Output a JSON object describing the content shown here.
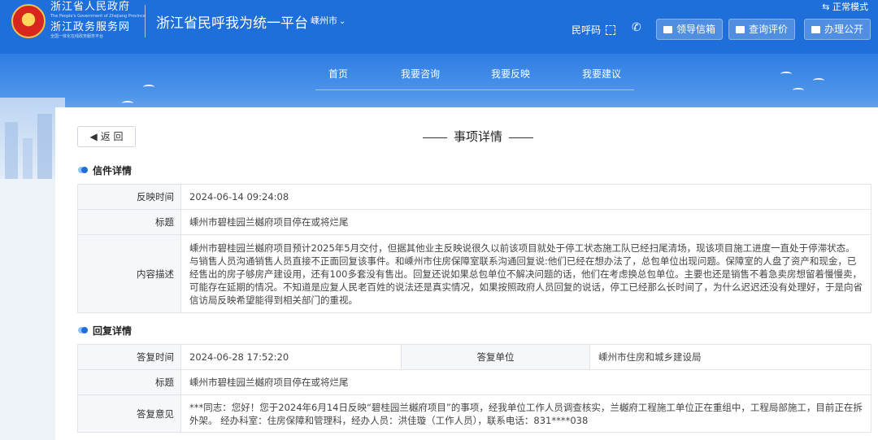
{
  "header": {
    "org_cn_1": "浙江省人民政府",
    "org_en_1": "The People's Government of Zhejiang Province",
    "org_cn_2": "浙江政务服务网",
    "org_en_2": "全国一体化在线政务服务平台",
    "platform_title": "浙江省民呼我为统一平台",
    "city": "嵊州市",
    "mode": "⇆ 正常模式",
    "hotline_label": "民呼码",
    "buttons": {
      "leader_mailbox": "领导信箱",
      "query_review": "查询评价",
      "public": "办理公开"
    }
  },
  "nav": {
    "home": "首页",
    "consult": "我要咨询",
    "feedback": "我要反映",
    "suggest": "我要建议"
  },
  "page": {
    "back_label": "返 回",
    "title": "事项详情"
  },
  "letter": {
    "section_title": "信件详情",
    "time_label": "反映时间",
    "time_value": "2024-06-14 09:24:08",
    "subject_label": "标题",
    "subject_value": "嵊州市碧桂园兰樾府项目停在或将烂尾",
    "content_label": "内容描述",
    "content_value": "嵊州市碧桂园兰樾府项目预计2025年5月交付，但据其他业主反映说很久以前该项目就处于停工状态施工队已经扫尾清场，现该项目施工进度一直处于停滞状态。与销售人员沟通销售人员直接不正面回复该事件。和嵊州市住房保障室联系沟通回复说:他们已经在想办法了，总包单位出现问题。保障室的人盘了资产和现金，已经售出的房子够房产建设用，还有100多套没有售出。回复还说如果总包单位不解决问题的话，他们在考虑换总包单位。主要也还是销售不着急卖房想留着慢慢卖，可能存在延期的情况。不知道是应复人民老百姓的说法还是真实情况，如果按照政府人员回复的说话，停工已经那么长时间了，为什么迟迟还没有处理好，于是向省信访局反映希望能得到相关部门的重视。"
  },
  "reply": {
    "section_title": "回复详情",
    "time_label": "答复时间",
    "time_value": "2024-06-28 17:52:20",
    "unit_label": "答复单位",
    "unit_value": "嵊州市住房和城乡建设局",
    "subject_label": "标题",
    "subject_value": "嵊州市碧桂园兰樾府项目停在或将烂尾",
    "opinion_label": "答复意见",
    "opinion_value": "***同志：您好！您于2024年6月14日反映“碧桂园兰樾府项目”的事项，经我单位工作人员调查核实，兰樾府工程施工单位正在重组中，工程局部施工，目前正在拆外架。 经办科室：住房保障和管理科，经办人员：洪佳璇（工作人员），联系电话：831****038"
  },
  "icons": [
    "national-emblem-icon",
    "chevron-down-icon",
    "switch-icon",
    "qr-code-icon",
    "phone-icon",
    "mail-icon",
    "comment-icon",
    "book-icon",
    "back-arrow-icon",
    "section-dot-icon"
  ],
  "colors": {
    "primary": "#1e6fd9",
    "label_bg": "#f5f7fa",
    "border": "#e1e5ea"
  }
}
